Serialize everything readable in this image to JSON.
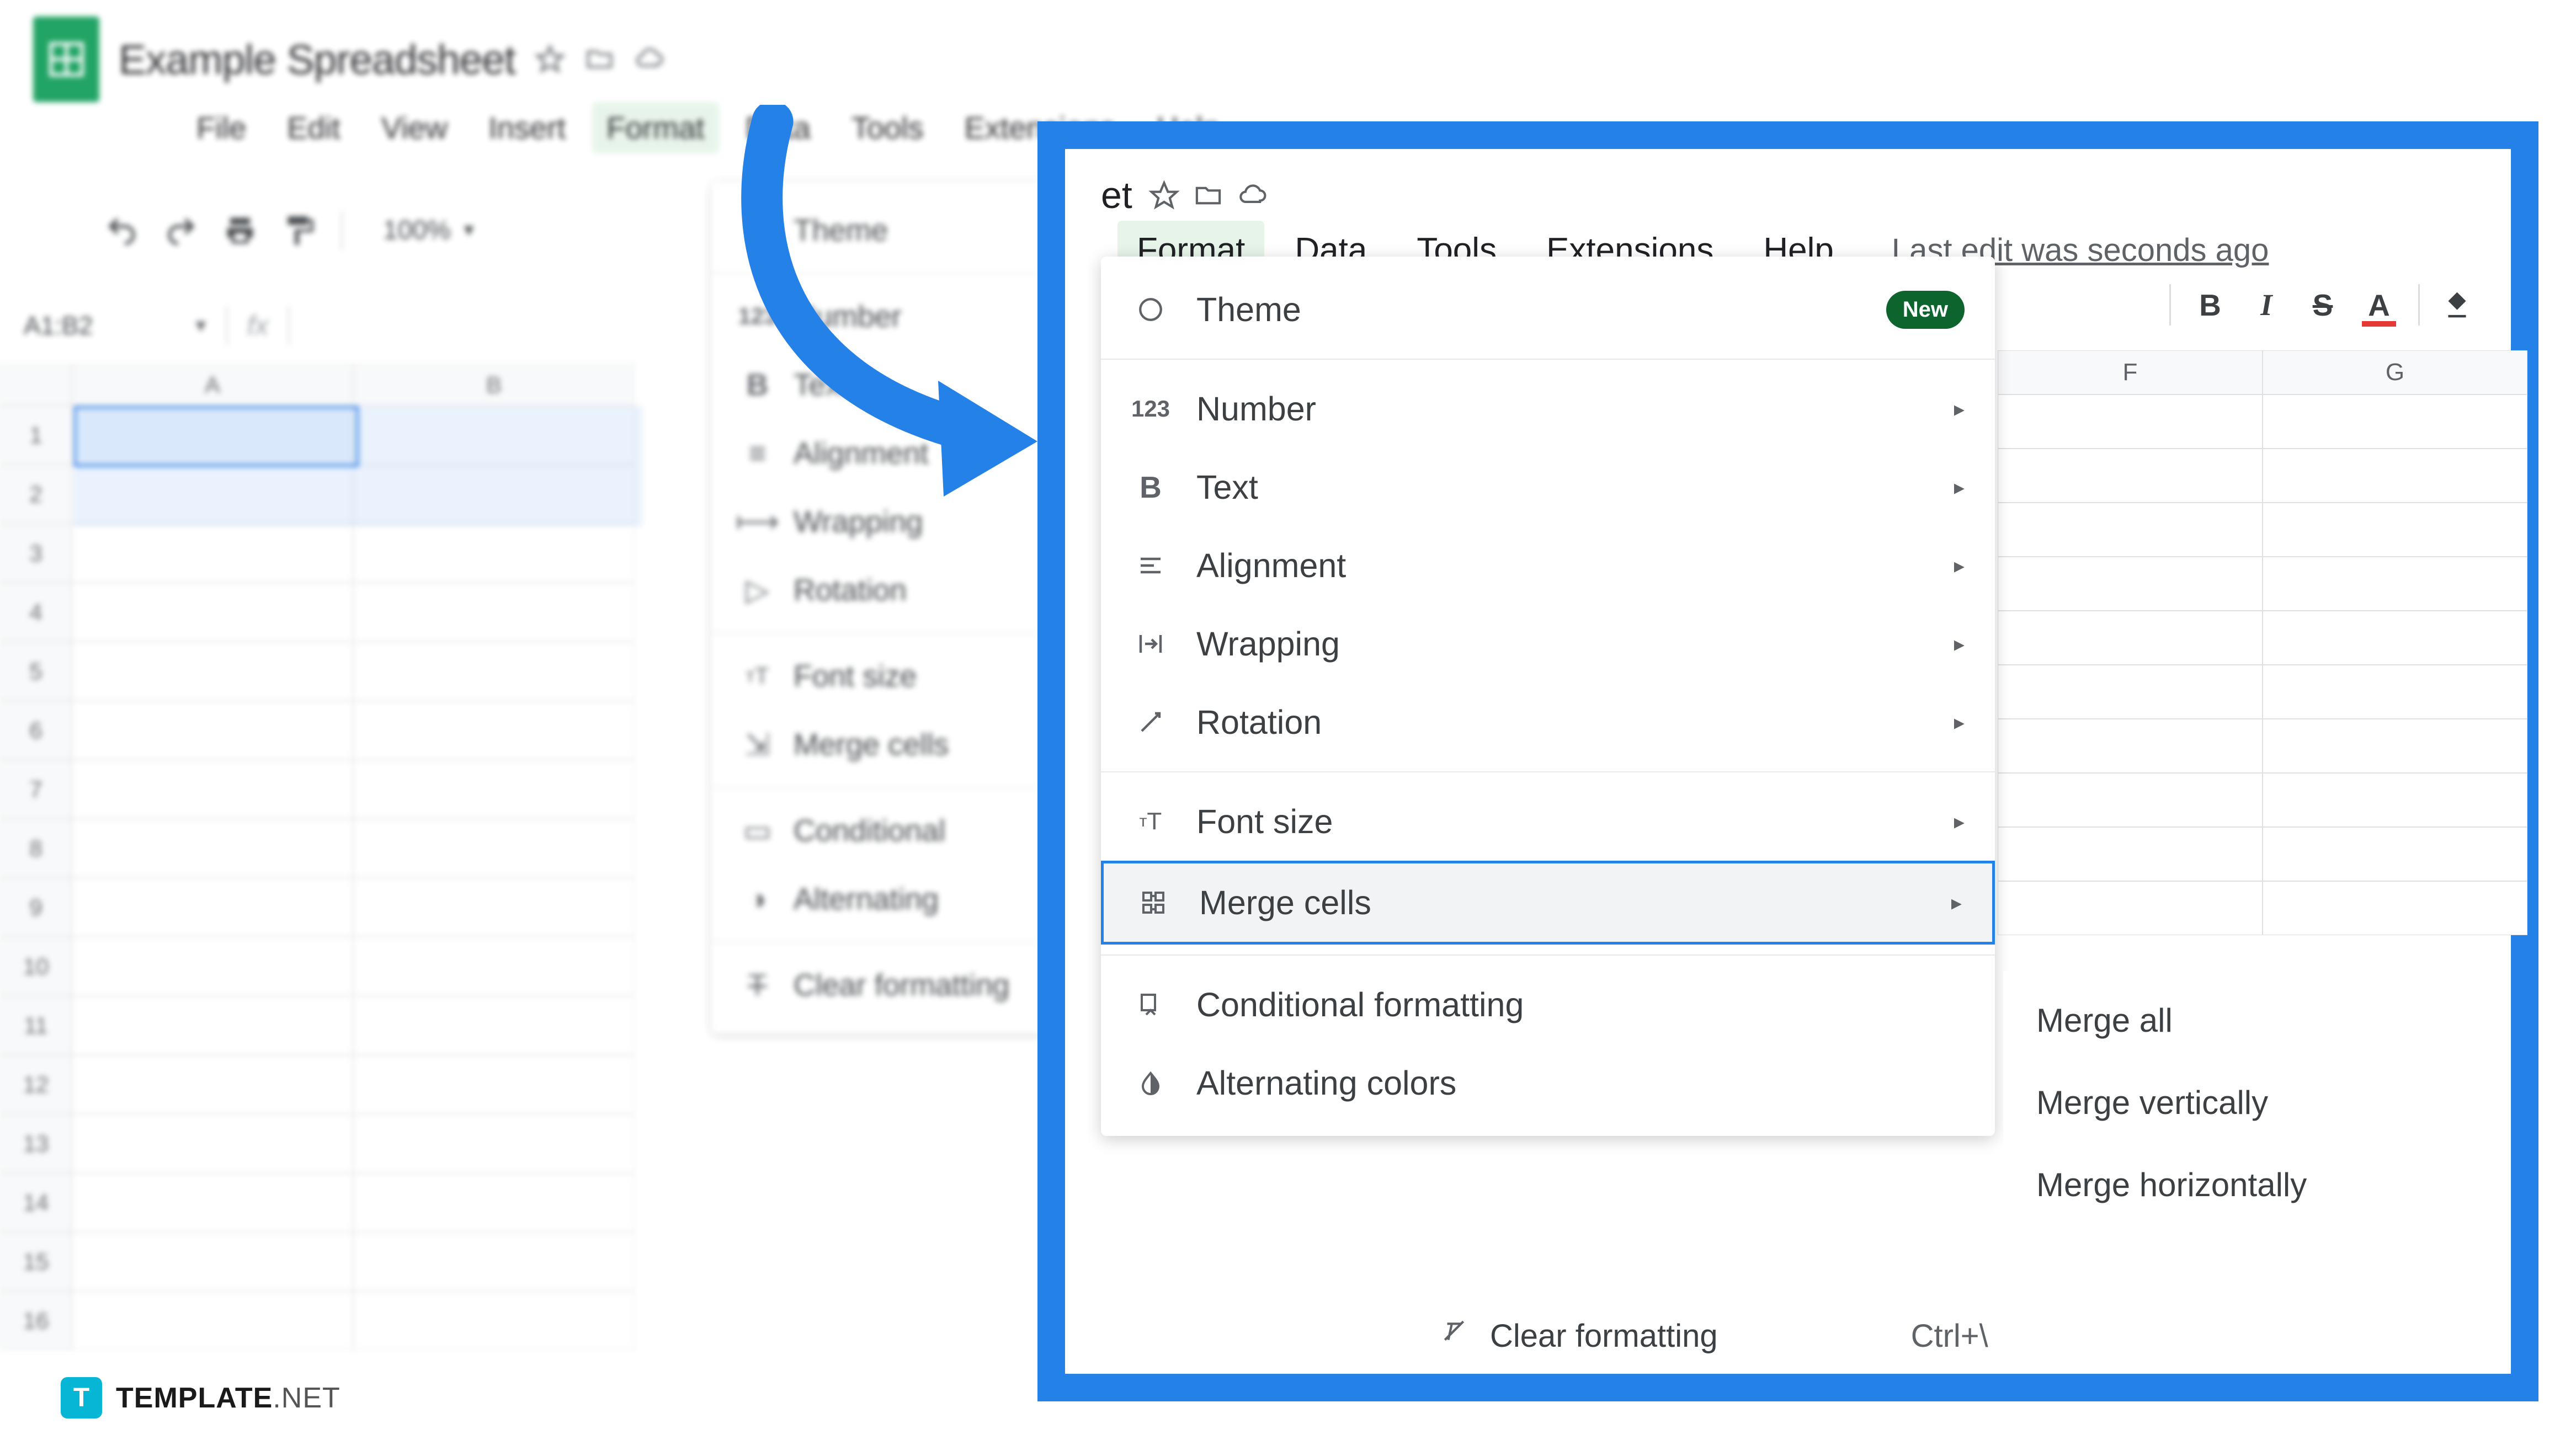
{
  "doc": {
    "title": "Example Spreadsheet"
  },
  "menubar": [
    "File",
    "Edit",
    "View",
    "Insert",
    "Format",
    "Data",
    "Tools",
    "Extensions",
    "Help"
  ],
  "lastedit": "Last edit was seconds ago",
  "toolbar": {
    "zoom": "100%"
  },
  "namebox": {
    "ref": "A1:B2",
    "fx": "fx"
  },
  "columns": [
    "A",
    "B"
  ],
  "rows": [
    "1",
    "2",
    "3",
    "4",
    "5",
    "6",
    "7",
    "8",
    "9",
    "10",
    "11",
    "12",
    "13",
    "14",
    "15",
    "16"
  ],
  "bg_format_menu": [
    "Theme",
    "Number",
    "Text",
    "Alignment",
    "Wrapping",
    "Rotation",
    "Font size",
    "Merge cells",
    "Conditional",
    "Alternating",
    "Clear formatting"
  ],
  "detail_menubar": [
    "Format",
    "Data",
    "Tools",
    "Extensions",
    "Help"
  ],
  "badge": "New",
  "format_menu": [
    {
      "icon": "theme",
      "label": "Theme",
      "badge": true
    },
    {
      "div": true
    },
    {
      "icon": "123",
      "label": "Number",
      "chev": true
    },
    {
      "icon": "B",
      "label": "Text",
      "chev": true
    },
    {
      "icon": "align",
      "label": "Alignment",
      "chev": true
    },
    {
      "icon": "wrap",
      "label": "Wrapping",
      "chev": true
    },
    {
      "icon": "rot",
      "label": "Rotation",
      "chev": true
    },
    {
      "div": true
    },
    {
      "icon": "tT",
      "label": "Font size",
      "chev": true
    },
    {
      "icon": "merge",
      "label": "Merge cells",
      "chev": true,
      "hl": true
    },
    {
      "div": true
    },
    {
      "icon": "cond",
      "label": "Conditional formatting"
    },
    {
      "icon": "alt",
      "label": "Alternating colors"
    }
  ],
  "clear_fmt": {
    "label": "Clear formatting",
    "short": "Ctrl+\\"
  },
  "submenu": [
    "Merge all",
    "Merge vertically",
    "Merge horizontally"
  ],
  "dcols": [
    "F",
    "G"
  ],
  "watermark": {
    "icon": "T",
    "bold": "TEMPLATE",
    "light": ".NET"
  }
}
